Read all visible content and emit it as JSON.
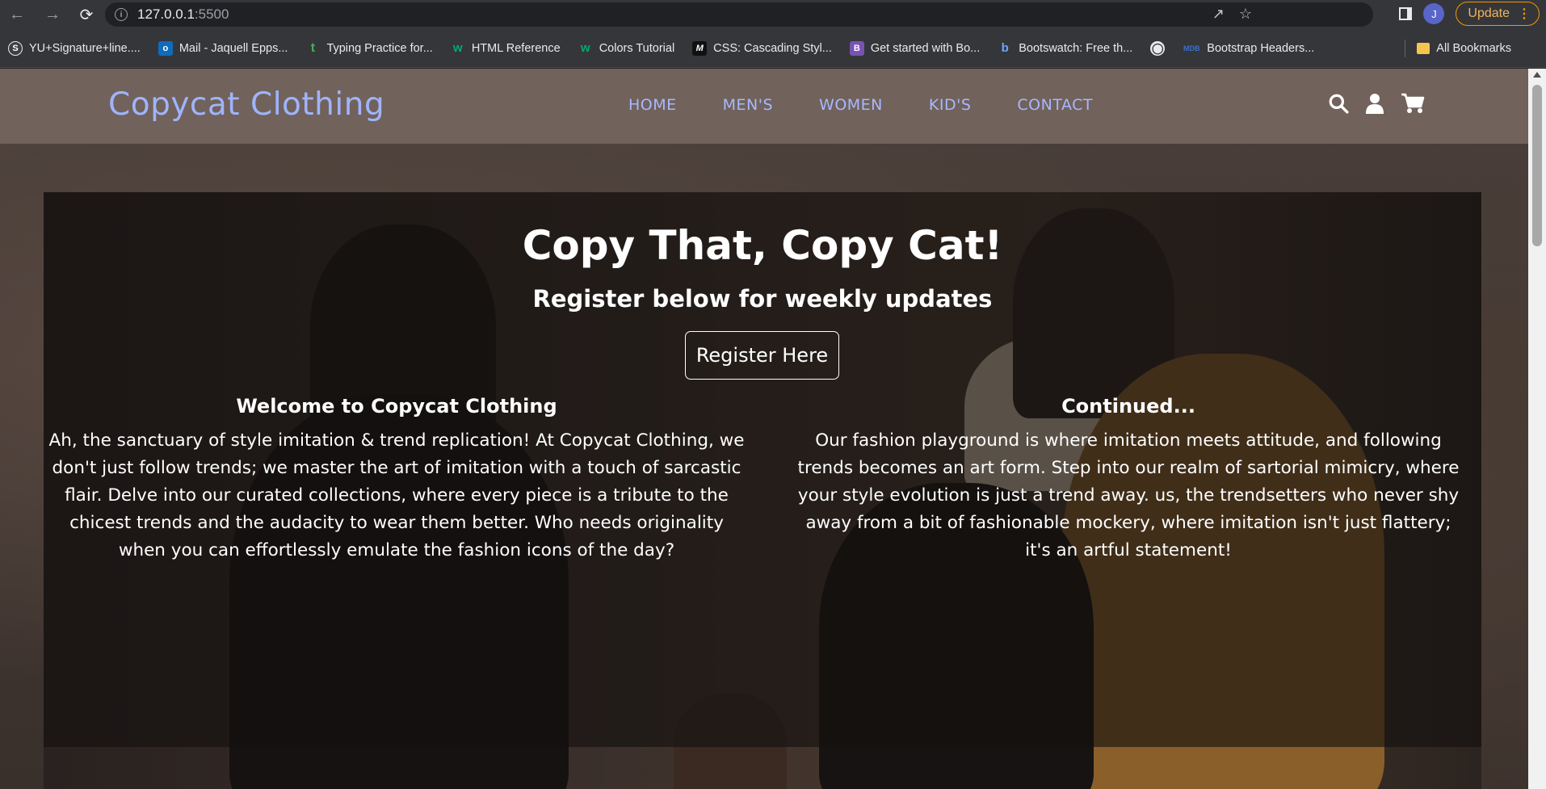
{
  "browser": {
    "url_host": "127.0.0.1",
    "url_port": ":5500",
    "profile_initial": "J",
    "update_label": "Update",
    "bookmarks": [
      {
        "label": "YU+Signature+line....",
        "icon": "S",
        "color": "#3c4043"
      },
      {
        "label": "Mail - Jaquell Epps...",
        "icon": "o",
        "color": "#0f6cbd"
      },
      {
        "label": "Typing Practice for...",
        "icon": "t",
        "color": "#2e7d32"
      },
      {
        "label": "HTML Reference",
        "icon": "w",
        "color": "#04aa6d"
      },
      {
        "label": "Colors Tutorial",
        "icon": "w",
        "color": "#04aa6d"
      },
      {
        "label": "CSS: Cascading Styl...",
        "icon": "M",
        "color": "#111111"
      },
      {
        "label": "Get started with Bo...",
        "icon": "B",
        "color": "#7952b3"
      },
      {
        "label": "Bootswatch: Free th...",
        "icon": "b",
        "color": "#2b6cb0"
      },
      {
        "label": "",
        "icon": "globe",
        "color": "#3c4043"
      },
      {
        "label": "Bootstrap Headers...",
        "icon": "MDB",
        "color": "#3b71ca"
      }
    ],
    "all_bookmarks": "All Bookmarks"
  },
  "site": {
    "brand": "Copycat Clothing",
    "nav": [
      "HOME",
      "MEN'S",
      "WOMEN",
      "KID'S",
      "CONTACT"
    ],
    "icons": [
      "search-icon",
      "user-icon",
      "cart-icon"
    ],
    "hero": {
      "title": "Copy That, Copy Cat!",
      "subtitle": "Register below for weekly updates",
      "cta": "Register Here"
    },
    "left": {
      "heading": "Welcome to Copycat Clothing",
      "body": "Ah, the sanctuary of style imitation & trend replication! At Copycat Clothing, we don't just follow trends; we master the art of imitation with a touch of sarcastic flair. Delve into our curated collections, where every piece is a tribute to the chicest trends and the audacity to wear them better. Who needs originality when you can effortlessly emulate the fashion icons of the day?"
    },
    "right": {
      "heading": "Continued...",
      "body": "Our fashion playground is where imitation meets attitude, and following trends becomes an art form. Step into our realm of sartorial mimicry, where your style evolution is just a trend away. us, the trendsetters who never shy away from a bit of fashionable mockery, where imitation isn't just flattery; it's an artful statement!"
    }
  },
  "colors": {
    "navbar": "#71625b",
    "brand": "#9fb4ff",
    "update_accent": "#f29900"
  }
}
